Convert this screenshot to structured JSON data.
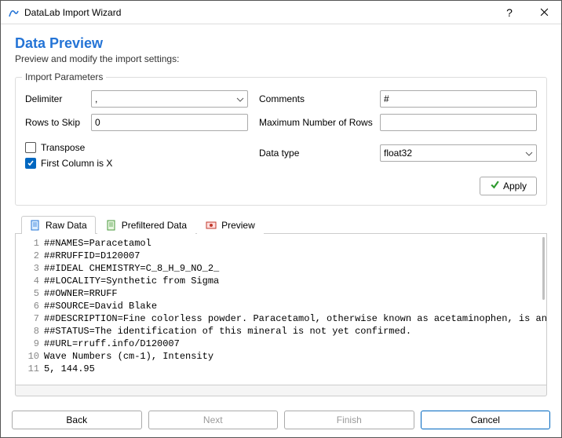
{
  "window": {
    "title": "DataLab Import Wizard"
  },
  "page": {
    "heading": "Data Preview",
    "subtitle": "Preview and modify the import settings:"
  },
  "group": {
    "title": "Import Parameters",
    "delimiter_label": "Delimiter",
    "delimiter_value": ",",
    "rows_to_skip_label": "Rows to Skip",
    "rows_to_skip_value": "0",
    "transpose_label": "Transpose",
    "first_column_x_label": "First Column is X",
    "comments_label": "Comments",
    "comments_value": "#",
    "max_rows_label": "Maximum Number of Rows",
    "max_rows_value": "",
    "data_type_label": "Data type",
    "data_type_value": "float32",
    "apply_label": "Apply"
  },
  "tabs": {
    "raw": "Raw Data",
    "prefiltered": "Prefiltered Data",
    "preview": "Preview"
  },
  "raw_lines": [
    "##NAMES=Paracetamol",
    "##RRUFFID=D120007",
    "##IDEAL CHEMISTRY=C_8_H_9_NO_2_",
    "##LOCALITY=Synthetic from Sigma",
    "##OWNER=RRUFF",
    "##SOURCE=David Blake",
    "##DESCRIPTION=Fine colorless powder. Paracetamol, otherwise known as acetaminophen, is an analgesic",
    "##STATUS=The identification of this mineral is not yet confirmed.",
    "##URL=rruff.info/D120007",
    "Wave Numbers (cm-1), Intensity",
    "5, 144.95"
  ],
  "buttons": {
    "back": "Back",
    "next": "Next",
    "finish": "Finish",
    "cancel": "Cancel"
  }
}
